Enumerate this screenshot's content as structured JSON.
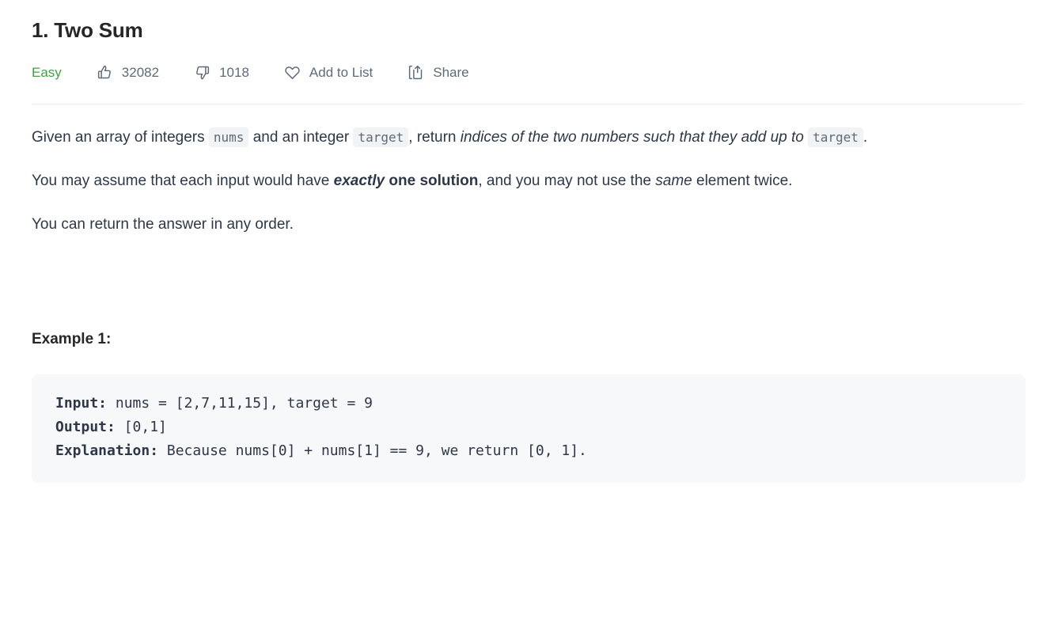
{
  "problem": {
    "title": "1. Two Sum",
    "difficulty": "Easy",
    "difficulty_color": "#43a047"
  },
  "meta_bar": {
    "likes_icon": "thumbs-up-icon",
    "likes": "32082",
    "dislikes_icon": "thumbs-down-icon",
    "dislikes": "1018",
    "favorite_icon": "heart-icon",
    "favorite_label": "Add to List",
    "share_icon": "share-icon",
    "share_label": "Share"
  },
  "description": {
    "p1": {
      "part1": "Given an array of integers ",
      "code1": "nums",
      "part2": " and an integer ",
      "code2": "target",
      "part3": ", return ",
      "italic1": "indices of the two numbers such that they add up to ",
      "code3": "target",
      "part4": "."
    },
    "p2": {
      "part1": "You may assume that each input would have ",
      "bold_italic": "exactly",
      "bold": " one solution",
      "part2": ", and you may not use the ",
      "italic": "same",
      "part3": " element twice."
    },
    "p3": "You can return the answer in any order."
  },
  "example": {
    "heading": "Example 1:",
    "input_label": "Input:",
    "input_value": " nums = [2,7,11,15], target = 9",
    "output_label": "Output:",
    "output_value": " [0,1]",
    "explanation_label": "Explanation:",
    "explanation_value": " Because nums[0] + nums[1] == 9, we return [0, 1]."
  }
}
